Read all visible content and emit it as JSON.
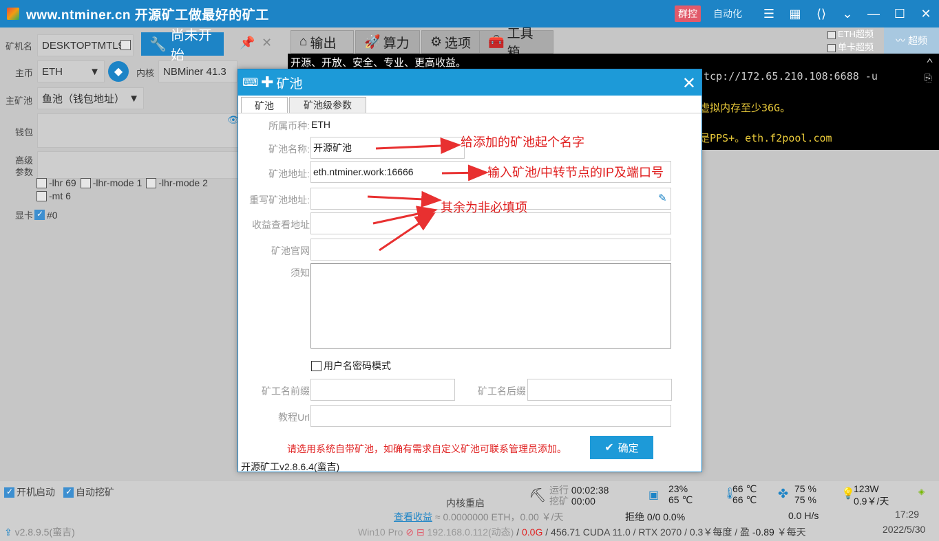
{
  "titlebar": {
    "title": "www.ntminer.cn 开源矿工做最好的矿工",
    "group_control": "群控",
    "auto": "自动化"
  },
  "left": {
    "miner_label": "矿机名",
    "miner_value": "DESKTOPTMTL9",
    "start_label": "尚未开始",
    "coin_label": "主币",
    "coin_value": "ETH",
    "kernel_label": "内核",
    "kernel_value": "NBMiner 41.3",
    "pool_label": "主矿池",
    "pool_value": "鱼池（钱包地址）",
    "wallet_label": "钱包",
    "adv_label_1": "高级",
    "adv_label_2": "参数",
    "opts": [
      "-lhr 69",
      "-lhr-mode 1",
      "-lhr-mode 2",
      "-mt 6"
    ],
    "gpu_label": "显卡",
    "gpu_value": "#0"
  },
  "tabs": {
    "output": "输出",
    "hashrate": "算力",
    "options": "选项",
    "toolbox": "工具箱",
    "eth_hp": "ETH超频",
    "single_hp": "单卡超频",
    "chaopin": "超频"
  },
  "console": {
    "line1": "开源、开放、安全、专业、更高收益。",
    "line2": "tcp://172.65.210.108:6688 -u",
    "line3": "虚拟内存至少36G。",
    "line4": "是PPS+。eth.f2pool.com"
  },
  "dialog": {
    "title": "矿池",
    "tab_pool": "矿池",
    "tab_params": "矿池级参数",
    "coin_label": "所属币种:",
    "coin_value": "ETH",
    "name_label": "矿池名称:",
    "name_value": "开源矿池",
    "addr_label": "矿池地址:",
    "addr_value": "eth.ntminer.work:16666",
    "rewrite_label": "重写矿池地址:",
    "income_label": "收益查看地址",
    "site_label": "矿池官网",
    "notice_label": "须知",
    "userpass_label": "用户名密码模式",
    "prefix_label": "矿工名前缀",
    "suffix_label": "矿工名后缀",
    "tutorial_label": "教程Url",
    "warning": "请选用系统自带矿池，如确有需求自定义矿池可联系管理员添加。",
    "ok": "确定",
    "version": "开源矿工v2.8.6.4(蛮吉)"
  },
  "annotations": {
    "a1": "给添加的矿池起个名字",
    "a2": "输入矿池/中转节点的IP及端口号",
    "a3": "其余为非必填项"
  },
  "bottom": {
    "boot": "开机启动",
    "auto_mine": "自动挖矿",
    "kernel_restart": "内核重启",
    "run_label": "运行",
    "run_time": "00:02:38",
    "mine_label": "挖矿",
    "mine_time": "00:00",
    "cpu1": "23%",
    "cpu2": "65 ℃",
    "temp1": "66 ℃",
    "temp2": "66 ℃",
    "fan1": "75 %",
    "fan2": "75 %",
    "power1": "123W",
    "power2": "0.9￥/天",
    "income_link": "查看收益",
    "income_value": "≈ 0.0000000 ETH，0.00 ￥/天",
    "reject": "拒绝 0/0  0.0%",
    "speed": "0.0 H/s",
    "time": "17:29",
    "version": "v2.8.9.5(蛮吉)",
    "status": "Win10 Pro",
    "ip": "192.168.0.112(动态)",
    "mem": "0.0G",
    "info": "/ 456.71 CUDA 11.0 / RTX 2070 / 0.3￥每度 / 盈",
    "profit": "-0.89",
    "per_day": "￥每天",
    "date": "2022/5/30"
  }
}
